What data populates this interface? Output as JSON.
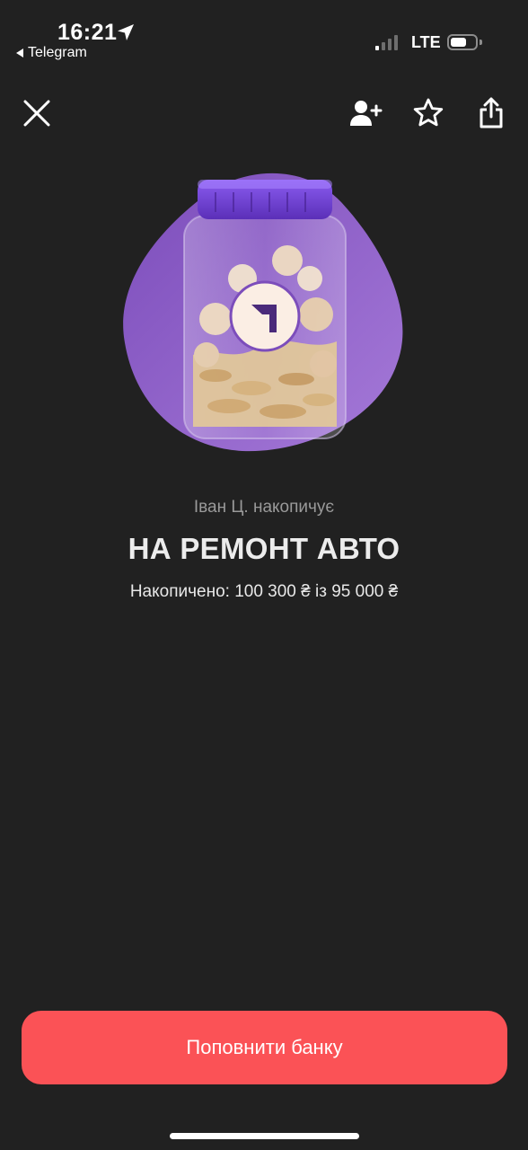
{
  "status_bar": {
    "time": "16:21",
    "back_app": "Telegram",
    "network": "LTE"
  },
  "toolbar": {
    "close_icon": "close-icon",
    "add_user_icon": "add-user-icon",
    "star_icon": "star-icon",
    "share_icon": "share-icon"
  },
  "jar": {
    "owner_line": "Іван Ц. накопичує",
    "title": "НА РЕМОНТ АВТО",
    "progress_line": "Накопичено: 100 300 ₴ із 95 000 ₴",
    "accumulated": "100 300 ₴",
    "goal": "95 000 ₴"
  },
  "action": {
    "topup_label": "Поповнити банку"
  },
  "colors": {
    "background": "#212121",
    "accent_button": "#fb5256",
    "blob_purple": "#8e5fc4",
    "lid_purple": "#6a3fd0",
    "secondary_text": "#9a9a9a"
  }
}
